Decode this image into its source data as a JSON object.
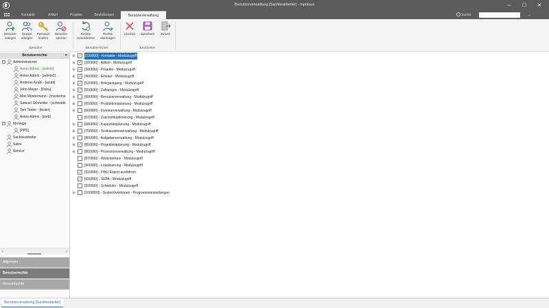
{
  "window": {
    "title": "Benutzerverwaltung [Sachbearbeiter] - mpnious",
    "controls": [
      "minimize",
      "maximize",
      "close"
    ]
  },
  "tabs": [
    {
      "label": "Kontakte",
      "active": false
    },
    {
      "label": "Artikel",
      "active": false
    },
    {
      "label": "Projekte",
      "active": false
    },
    {
      "label": "Bestellungen",
      "active": false
    },
    {
      "label": "Benutzerverwaltung",
      "active": true
    }
  ],
  "search": {
    "label": "Suche:",
    "value": ""
  },
  "ribbon": {
    "groups": [
      {
        "label": "Benutzer"
      },
      {
        "label": "Benutzerrechte"
      },
      {
        "label": "Bearbeiten"
      }
    ],
    "buttons": {
      "user_create": {
        "line1": "Benutzer",
        "line2": "anlegen"
      },
      "group_create": {
        "line1": "Gruppe",
        "line2": "anlegen"
      },
      "password_change": {
        "line1": "Passwort",
        "line2": "ändern"
      },
      "user_lock": {
        "line1": "Benutzer",
        "line2": "sperren"
      },
      "rights_reset": {
        "line1": "Rechte",
        "line2": "zurücksetzen"
      },
      "rights_transfer": {
        "line1": "Rechte",
        "line2": "übertragen"
      },
      "delete": {
        "line1": "Löschen",
        "line2": ""
      },
      "save": {
        "line1": "Speichern",
        "line2": ""
      },
      "back": {
        "line1": "Zurück",
        "line2": ""
      }
    }
  },
  "left_panel": {
    "header": "Benutzerrechte",
    "tree": {
      "administrators": {
        "label": "Administratoren",
        "children": [
          {
            "label": "Anton Admin - [admin]",
            "selected": true
          },
          {
            "label": "Anton Admin - [admin2]",
            "selected": false
          },
          {
            "label": "Andreas Azubi - [azubi]",
            "selected": false
          },
          {
            "label": "John Meyer - [Doku]",
            "selected": false
          },
          {
            "label": "Max Mustermann - [musterme",
            "selected": false
          },
          {
            "label": "Samuel Schneider - [schneide",
            "selected": false
          },
          {
            "label": "Toni Tester - [tester]",
            "selected": false
          },
          {
            "label": "Anton Admin - [web]",
            "selected": false
          }
        ]
      },
      "montage": {
        "label": "Montage",
        "children": [
          {
            "label": "[PPS]"
          }
        ]
      },
      "others": [
        {
          "label": "Sachbearbeiter"
        },
        {
          "label": "Sales"
        },
        {
          "label": "Service"
        }
      ]
    },
    "sections": [
      {
        "label": "Allgemein",
        "active": false
      },
      {
        "label": "Benutzerrechte",
        "active": true
      },
      {
        "label": "Ressortrechte",
        "active": false
      }
    ]
  },
  "rights": [
    {
      "label": "[100000] - Kontakte - Modulzugriff",
      "checked": true,
      "expandable": true,
      "highlighted": true
    },
    {
      "label": "[200000] - Artikel - Modulzugriff",
      "checked": true,
      "expandable": true,
      "highlighted": false
    },
    {
      "label": "[300000] - Projekte - Modulzugriff",
      "checked": true,
      "expandable": true,
      "highlighted": false
    },
    {
      "label": "[400000] - Einkauf - Modulzugriff",
      "checked": true,
      "expandable": true,
      "highlighted": false
    },
    {
      "label": "[520000] - Belegeingang - Modulzugriff",
      "checked": true,
      "expandable": true,
      "highlighted": false
    },
    {
      "label": "[550000] - Zahlungen - Modulzugriff",
      "checked": true,
      "expandable": true,
      "highlighted": false
    },
    {
      "label": "[600000] - Benutzerverwaltung - Modulzugriff",
      "checked": false,
      "expandable": true,
      "highlighted": false
    },
    {
      "label": "[650000] - Produktionsplanung - Modulzugriff",
      "checked": false,
      "expandable": true,
      "highlighted": false
    },
    {
      "label": "[660000] - Inventurverwaltung - Modulzugriff",
      "checked": false,
      "expandable": true,
      "highlighted": false
    },
    {
      "label": "[670000] - Zuschnittoptimierung - Modulzugriff",
      "checked": false,
      "expandable": false,
      "highlighted": false
    },
    {
      "label": "[680000] - Kapazitätsplanung - Modulzugriff",
      "checked": false,
      "expandable": true,
      "highlighted": false
    },
    {
      "label": "[750000] - Testbausteinverwaltung - Modulzugriff",
      "checked": false,
      "expandable": true,
      "highlighted": false
    },
    {
      "label": "[800000] - Aufgabenverwaltung - Modulzugriff",
      "checked": false,
      "expandable": true,
      "highlighted": false
    },
    {
      "label": "[850000] - Projektzeitplanung - Modulzugriff",
      "checked": true,
      "expandable": true,
      "highlighted": false
    },
    {
      "label": "[860000] - Provisionsverwaltung - Modulzugriff",
      "checked": false,
      "expandable": true,
      "highlighted": false
    },
    {
      "label": "[870000] - Webinterface - Modulzugriff",
      "checked": false,
      "expandable": false,
      "highlighted": false
    },
    {
      "label": "[900000] - Lokalisierung - Modulzugriff",
      "checked": false,
      "expandable": false,
      "highlighted": false
    },
    {
      "label": "[910000] - FIBU Export ausführen",
      "checked": true,
      "expandable": false,
      "highlighted": false
    },
    {
      "label": "[920000] - SEPA - Modulzugriff",
      "checked": true,
      "expandable": false,
      "highlighted": false
    },
    {
      "label": "[930000] - Scheduler - Modulzugriff",
      "checked": false,
      "expandable": false,
      "highlighted": false
    },
    {
      "label": "[1000000] - Systemfunktionen - Programmeinstellungen",
      "checked": false,
      "expandable": true,
      "highlighted": false
    }
  ],
  "statusbar": {
    "tab_label": "Benutzerverwaltung [Sachbearbeiter]"
  },
  "colors": {
    "titlebar": "#5b5b5b",
    "accent": "#1f6fc8",
    "selected_user": "#2a9a2a"
  }
}
